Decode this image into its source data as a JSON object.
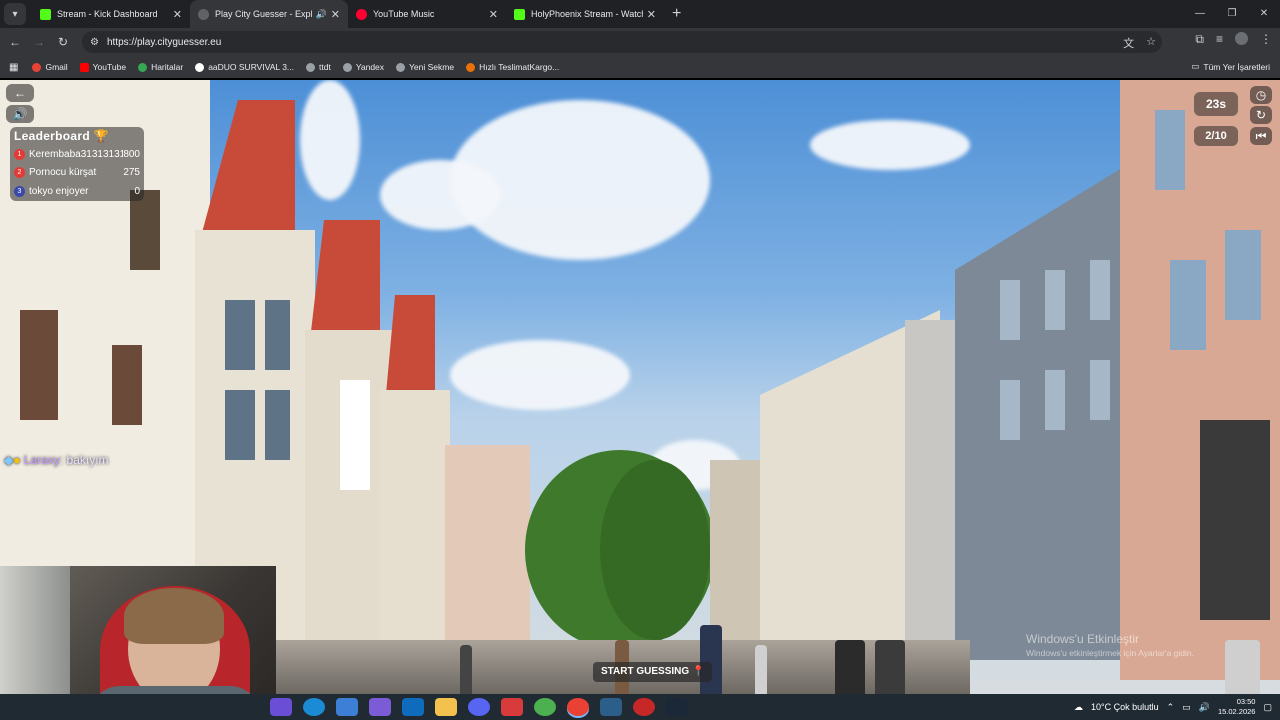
{
  "browser": {
    "tabs": [
      {
        "label": "Stream - Kick Dashboard",
        "color": "#53fc18"
      },
      {
        "label": "Play City Guesser - Explore",
        "color": "#5f6368"
      },
      {
        "label": "YouTube Music",
        "color": "#ff0033"
      },
      {
        "label": "HolyPhoenix Stream - Watch Li",
        "color": "#53fc18"
      }
    ],
    "url": "https://play.cityguesser.eu"
  },
  "bookmarks": [
    "Gmail",
    "YouTube",
    "Haritalar",
    "aaDUO SURVIVAL 3...",
    "ttdt",
    "Yandex",
    "Yeni Sekme",
    "Hızlı TeslimatKargo..."
  ],
  "bookmarks_all": "Tüm Yer İşaretleri",
  "game": {
    "timer": "23s",
    "round": "2/10",
    "start_button": "START GUESSING",
    "leaderboard_title": "Leaderboard",
    "leaderboard": [
      {
        "rank": "1",
        "name": "Kerembaba3131313131",
        "score": "800",
        "color": "#e53935"
      },
      {
        "rank": "2",
        "name": "Pornocu kürşat",
        "score": "275",
        "color": "#e53935"
      },
      {
        "rank": "3",
        "name": "tokyo enjoyer",
        "score": "0",
        "color": "#3949ab"
      }
    ]
  },
  "chat": {
    "user": "Laraxy",
    "message": ": bakıyım"
  },
  "watermark": {
    "title": "Windows'u Etkinleştir",
    "subtitle": "Windows'u etkinleştirmek için Ayarlar'a gidin."
  },
  "taskbar": {
    "weather": "10°C  Çok bulutlu",
    "time": "03:50",
    "date": "15.02.2026"
  }
}
